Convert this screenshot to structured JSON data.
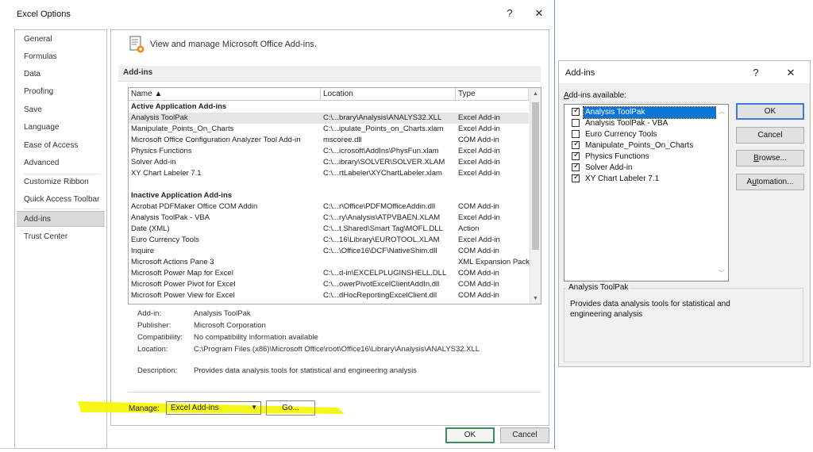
{
  "excel_options": {
    "title": "Excel Options",
    "help_label": "?",
    "close_label": "✕",
    "nav_items": [
      "General",
      "Formulas",
      "Data",
      "Proofing",
      "Save",
      "Language",
      "Ease of Access",
      "Advanced",
      "Customize Ribbon",
      "Quick Access Toolbar",
      "Add-ins",
      "Trust Center"
    ],
    "active_nav": "Add-ins",
    "header_text": "View and manage Microsoft Office Add-ins.",
    "section_title": "Add-ins",
    "columns": {
      "name": "Name ▲",
      "location": "Location",
      "type": "Type"
    },
    "active_group": "Active Application Add-ins",
    "active_rows": [
      {
        "name": "Analysis ToolPak",
        "location": "C:\\...brary\\Analysis\\ANALYS32.XLL",
        "type": "Excel Add-in"
      },
      {
        "name": "Manipulate_Points_On_Charts",
        "location": "C:\\...ipulate_Points_on_Charts.xlam",
        "type": "Excel Add-in"
      },
      {
        "name": "Microsoft Office Configuration Analyzer Tool Add-in",
        "location": "mscoree.dll",
        "type": "COM Add-in"
      },
      {
        "name": "Physics Functions",
        "location": "C:\\...icrosoft\\AddIns\\PhysFun.xlam",
        "type": "Excel Add-in"
      },
      {
        "name": "Solver Add-in",
        "location": "C:\\...ibrary\\SOLVER\\SOLVER.XLAM",
        "type": "Excel Add-in"
      },
      {
        "name": "XY Chart Labeler 7.1",
        "location": "C:\\...rtLabeler\\XYChartLabeler.xlam",
        "type": "Excel Add-in"
      }
    ],
    "inactive_group": "Inactive Application Add-ins",
    "inactive_rows": [
      {
        "name": "Acrobat PDFMaker Office COM Addin",
        "location": "C:\\...r\\Office\\PDFMOfficeAddin.dll",
        "type": "COM Add-in"
      },
      {
        "name": "Analysis ToolPak - VBA",
        "location": "C:\\...ry\\Analysis\\ATPVBAEN.XLAM",
        "type": "Excel Add-in"
      },
      {
        "name": "Date (XML)",
        "location": "C:\\...t Shared\\Smart Tag\\MOFL.DLL",
        "type": "Action"
      },
      {
        "name": "Euro Currency Tools",
        "location": "C:\\...16\\Library\\EUROTOOL.XLAM",
        "type": "Excel Add-in"
      },
      {
        "name": "Inquire",
        "location": "C:\\...\\Office16\\DCF\\NativeShim.dll",
        "type": "COM Add-in"
      },
      {
        "name": "Microsoft Actions Pane 3",
        "location": "",
        "type": "XML Expansion Pack"
      },
      {
        "name": "Microsoft Power Map for Excel",
        "location": "C:\\...d-in\\EXCELPLUGINSHELL.DLL",
        "type": "COM Add-in"
      },
      {
        "name": "Microsoft Power Pivot for Excel",
        "location": "C:\\...owerPivotExcelClientAddIn.dll",
        "type": "COM Add-in"
      },
      {
        "name": "Microsoft Power View for Excel",
        "location": "C:\\...dHocReportingExcelClient.dll",
        "type": "COM Add-in"
      }
    ],
    "details": {
      "addin_label": "Add-in:",
      "addin_value": "Analysis ToolPak",
      "publisher_label": "Publisher:",
      "publisher_value": "Microsoft Corporation",
      "compat_label": "Compatibility:",
      "compat_value": "No compatibility information available",
      "location_label": "Location:",
      "location_value": "C:\\Program Files (x86)\\Microsoft Office\\root\\Office16\\Library\\Analysis\\ANALYS32.XLL",
      "description_label": "Description:",
      "description_value": "Provides data analysis tools for statistical and engineering analysis"
    },
    "manage_label": "Manage:",
    "manage_value": "Excel Add-ins",
    "go_label": "Go...",
    "ok_label": "OK",
    "cancel_label": "Cancel",
    "highlight_color": "#f5f500"
  },
  "addins_dialog": {
    "title": "Add-ins",
    "help_label": "?",
    "close_label": "✕",
    "available_label": "Add-ins available:",
    "items": [
      {
        "label": "Analysis ToolPak",
        "checked": true
      },
      {
        "label": "Analysis ToolPak - VBA",
        "checked": false
      },
      {
        "label": "Euro Currency Tools",
        "checked": false
      },
      {
        "label": "Manipulate_Points_On_Charts",
        "checked": true
      },
      {
        "label": "Physics Functions",
        "checked": true
      },
      {
        "label": "Solver Add-in",
        "checked": true
      },
      {
        "label": "XY Chart Labeler 7.1",
        "checked": true
      }
    ],
    "selected_item": "Analysis ToolPak",
    "ok_label": "OK",
    "cancel_label": "Cancel",
    "browse_label": "Browse...",
    "automation_label": "Automation...",
    "group_title": "Analysis ToolPak",
    "description": "Provides data analysis tools for statistical and engineering analysis"
  }
}
